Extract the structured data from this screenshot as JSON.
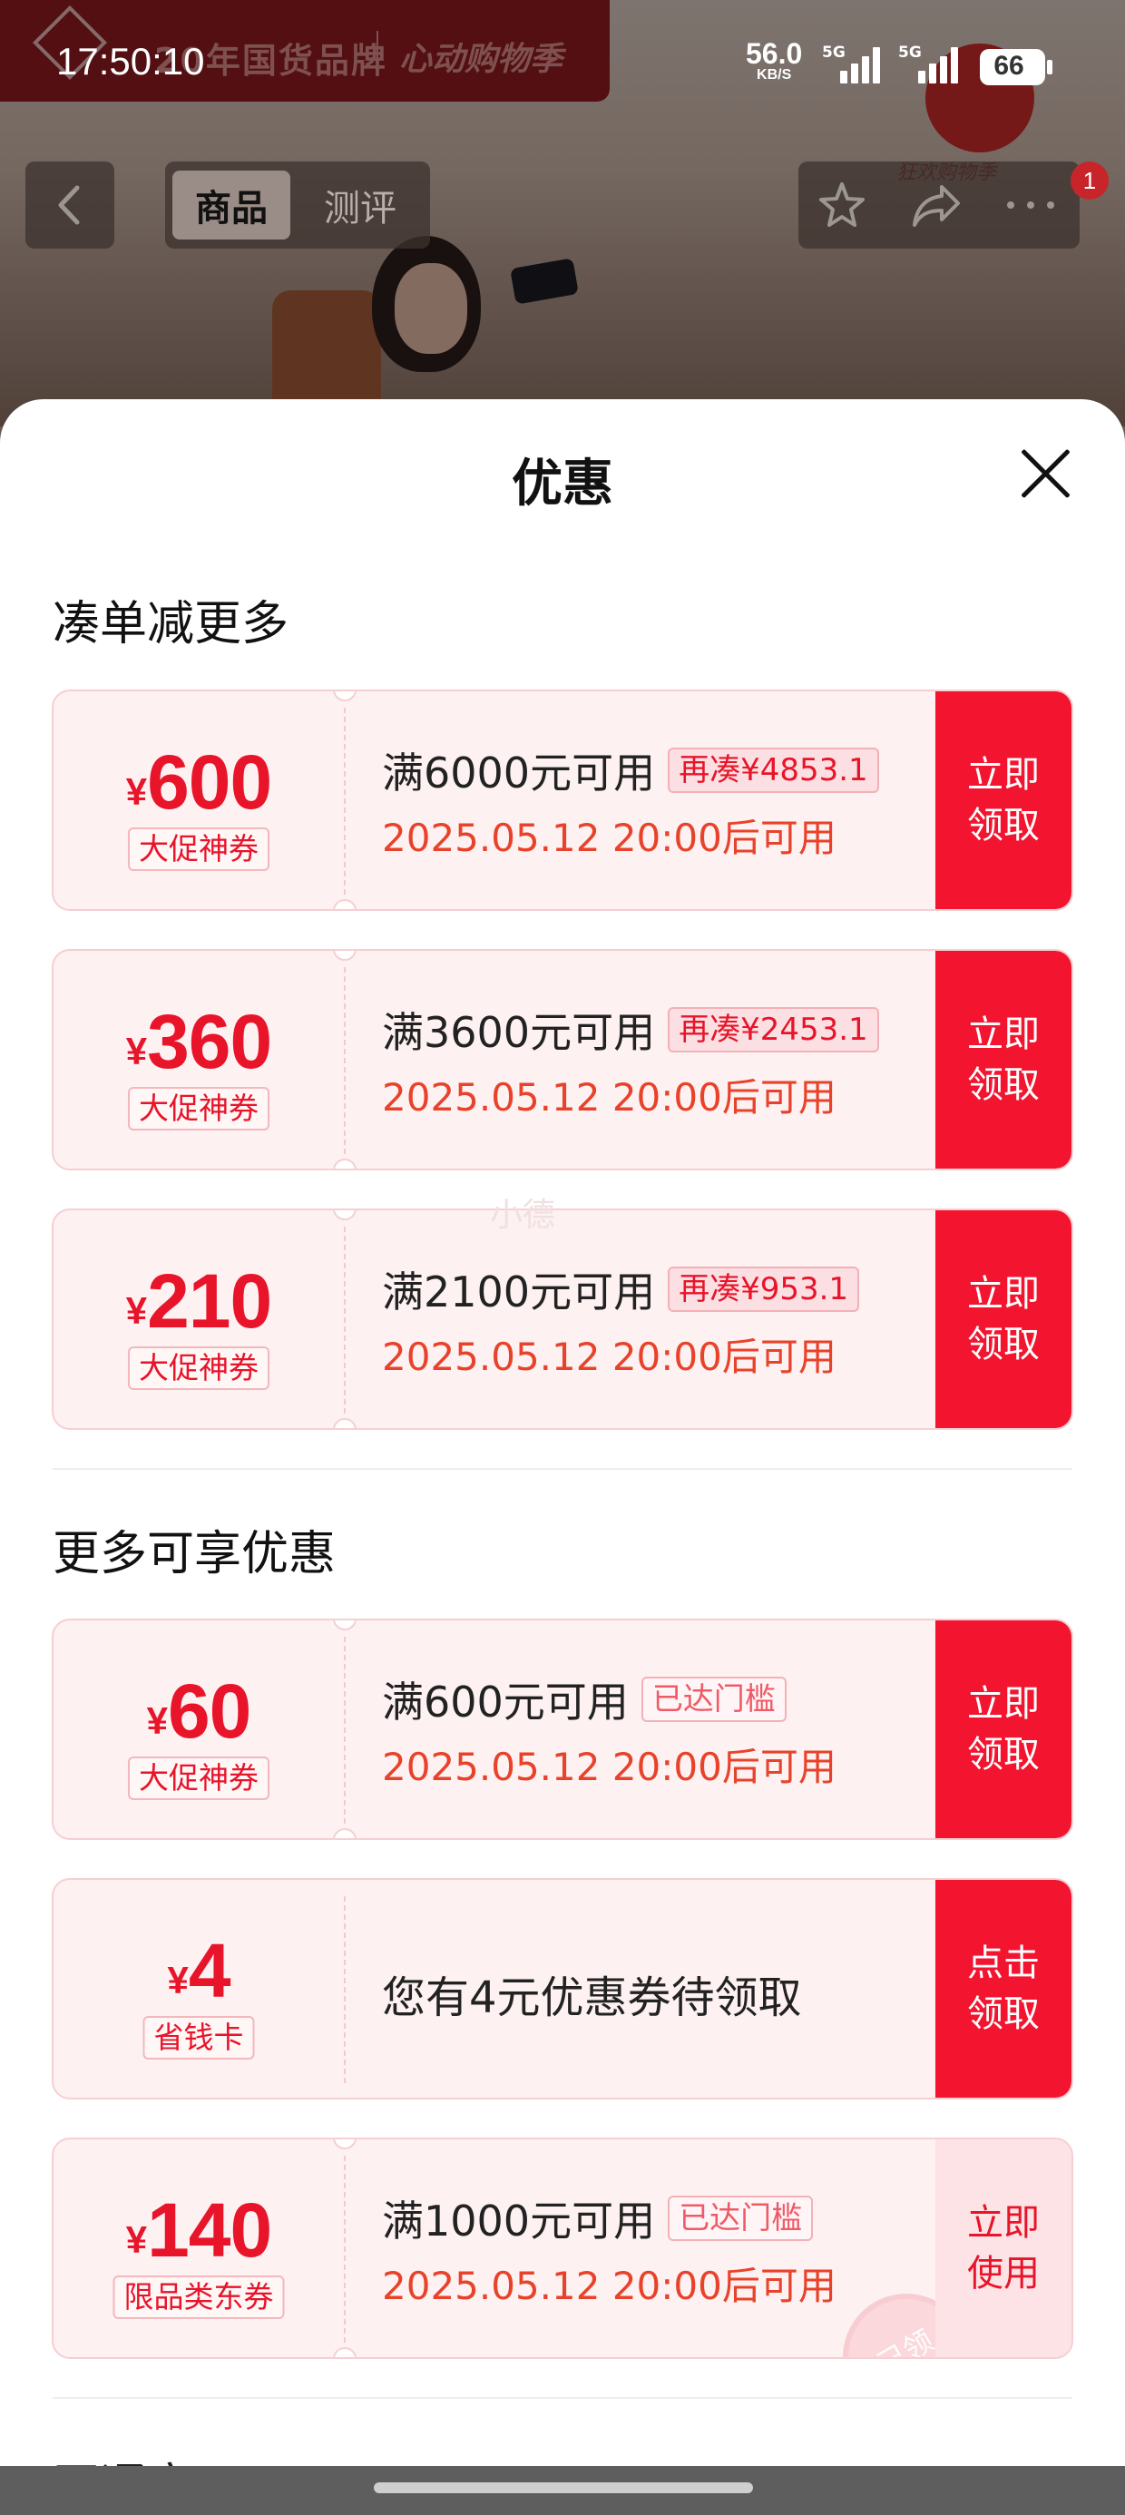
{
  "status_bar": {
    "time": "17:50:10",
    "net_speed": "56.0",
    "net_unit": "KB/S",
    "sim1": "5G",
    "sim2": "5G",
    "battery": "66"
  },
  "background": {
    "brand_text": "20年国货品牌",
    "brand_slogan": "心动购物季",
    "logo_caption": "狂欢购物季"
  },
  "nav": {
    "tabs": [
      {
        "label": "商品",
        "active": true
      },
      {
        "label": "测评",
        "active": false
      }
    ],
    "icons": [
      "back-icon",
      "star-icon",
      "share-icon",
      "more-icon"
    ],
    "badge": "1"
  },
  "sheet": {
    "title": "优惠",
    "sections": [
      {
        "title": "凑单减更多"
      },
      {
        "title": "更多可享优惠"
      }
    ],
    "next_section_partial": "开通享..."
  },
  "coupons": [
    {
      "currency": "¥",
      "amount": "600",
      "type": "大促神券",
      "condition": "满6000元可用",
      "tag": "再凑¥4853.1",
      "time": "2025.05.12 20:00后可用",
      "action": "立即\n领取"
    },
    {
      "currency": "¥",
      "amount": "360",
      "type": "大促神券",
      "condition": "满3600元可用",
      "tag": "再凑¥2453.1",
      "time": "2025.05.12 20:00后可用",
      "action": "立即\n领取"
    },
    {
      "currency": "¥",
      "amount": "210",
      "type": "大促神券",
      "condition": "满2100元可用",
      "tag": "再凑¥953.1",
      "time": "2025.05.12 20:00后可用",
      "action": "立即\n领取"
    },
    {
      "currency": "¥",
      "amount": "60",
      "type": "大促神券",
      "condition": "满600元可用",
      "tag": "已达门槛",
      "time": "2025.05.12 20:00后可用",
      "action": "立即\n领取"
    },
    {
      "currency": "¥",
      "amount": "4",
      "type": "省钱卡",
      "single_text": "您有4元优惠券待领取",
      "action": "点击\n领取"
    },
    {
      "currency": "¥",
      "amount": "140",
      "type": "限品类东券",
      "condition": "满1000元可用",
      "tag": "已达门槛",
      "time": "2025.05.12 20:00后可用",
      "action": "立即\n使用",
      "stamp": "已领"
    }
  ],
  "watermark": "小德",
  "colors": {
    "accent": "#f3142f",
    "coupon_bg": "#fdf1f2",
    "time_text": "#e8432a"
  }
}
